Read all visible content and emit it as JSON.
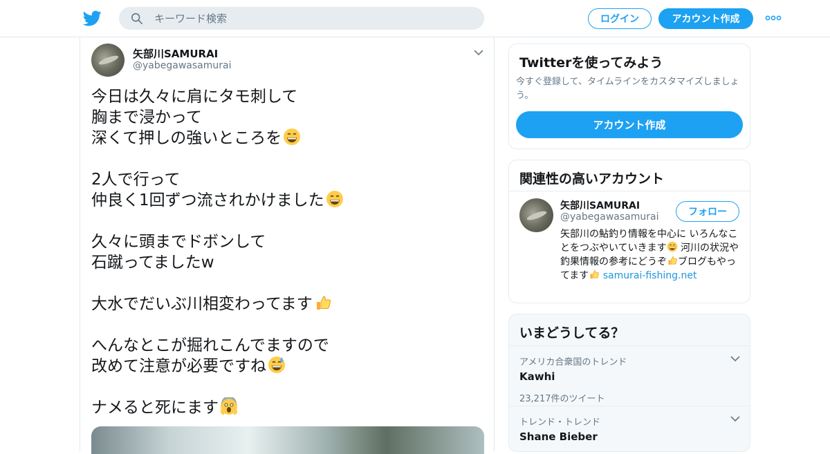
{
  "header": {
    "search_placeholder": "キーワード検索",
    "login_label": "ログイン",
    "signup_label": "アカウント作成",
    "brand_color": "#1da1f2"
  },
  "tweet": {
    "display_name": "矢部川SAMURAI",
    "handle": "@yabegawasamurai",
    "lines": [
      "今日は久々に肩にタモ刺して",
      "胸まで浸かって",
      "深くて押しの強いところを",
      "2人で行って",
      "仲良く1回ずつ流されかけました",
      "久々に頭までドボンして",
      "石蹴ってましたw",
      "大水でだいぶ川相変わってます",
      "へんなとこが掘れこんでますので",
      "改めて注意が必要ですね",
      "ナメると死にます"
    ]
  },
  "sidebar": {
    "signup_card": {
      "title": "Twitterを使ってみよう",
      "description": "今すぐ登録して、タイムラインをカスタマイズしましょう。",
      "button_label": "アカウント作成"
    },
    "related_card": {
      "title": "関連性の高いアカウント",
      "display_name": "矢部川SAMURAI",
      "handle": "@yabegawasamurai",
      "follow_label": "フォロー",
      "bio_1": "矢部川の鮎釣り情報を中心に いろんなことをつぶやいていきます",
      "bio_2": " 河川の状況や釣果情報の参考にどうぞ",
      "bio_3": "ブログもやってます",
      "bio_link": "samurai-fishing.net"
    },
    "trends_card": {
      "title": "いまどうしてる？",
      "trends": [
        {
          "context": "アメリカ合衆国のトレンド",
          "name": "Kawhi",
          "count": "23,217件のツイート"
        },
        {
          "context": "トレンド・トレンド",
          "name": "Shane Bieber",
          "count": ""
        }
      ]
    }
  }
}
